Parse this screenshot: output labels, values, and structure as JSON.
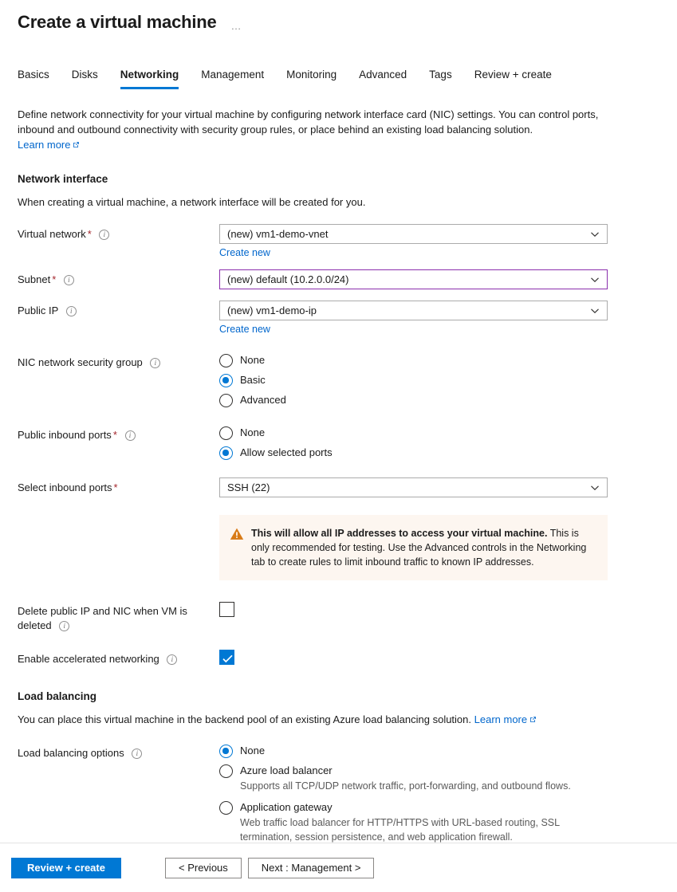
{
  "header": {
    "title": "Create a virtual machine",
    "more_menu": "…"
  },
  "colors": {
    "accent": "#0078d4",
    "link": "#0066cc",
    "required": "#a4262c",
    "warning_icon": "#d87a16",
    "warning_bg": "#fdf6f0",
    "focus_border": "#8b2fad"
  },
  "tabs": [
    {
      "label": "Basics",
      "active": false
    },
    {
      "label": "Disks",
      "active": false
    },
    {
      "label": "Networking",
      "active": true
    },
    {
      "label": "Management",
      "active": false
    },
    {
      "label": "Monitoring",
      "active": false
    },
    {
      "label": "Advanced",
      "active": false
    },
    {
      "label": "Tags",
      "active": false
    },
    {
      "label": "Review + create",
      "active": false
    }
  ],
  "intro": {
    "text": "Define network connectivity for your virtual machine by configuring network interface card (NIC) settings. You can control ports, inbound and outbound connectivity with security group rules, or place behind an existing load balancing solution.",
    "learn_more": "Learn more"
  },
  "network_interface": {
    "heading": "Network interface",
    "subtext": "When creating a virtual machine, a network interface will be created for you.",
    "virtual_network": {
      "label": "Virtual network",
      "required": "*",
      "value": "(new) vm1-demo-vnet",
      "create_new": "Create new",
      "focused": false
    },
    "subnet": {
      "label": "Subnet",
      "required": "*",
      "value": "(new) default (10.2.0.0/24)",
      "focused": true
    },
    "public_ip": {
      "label": "Public IP",
      "value": "(new) vm1-demo-ip",
      "create_new": "Create new",
      "focused": false
    },
    "nic_nsg": {
      "label": "NIC network security group",
      "selected": "Basic",
      "options": [
        "None",
        "Basic",
        "Advanced"
      ]
    },
    "public_inbound_ports": {
      "label": "Public inbound ports",
      "required": "*",
      "selected": "Allow selected ports",
      "options": [
        "None",
        "Allow selected ports"
      ]
    },
    "select_inbound_ports": {
      "label": "Select inbound ports",
      "required": "*",
      "value": "SSH (22)"
    },
    "warning": {
      "icon": "warning-triangle-icon",
      "strong": "This will allow all IP addresses to access your virtual machine.",
      "rest": "This is only recommended for testing.  Use the Advanced controls in the Networking tab to create rules to limit inbound traffic to known IP addresses."
    },
    "delete_public_ip": {
      "label": "Delete public IP and NIC when VM is deleted",
      "checked": false
    },
    "accelerated_networking": {
      "label": "Enable accelerated networking",
      "checked": true
    }
  },
  "load_balancing": {
    "heading": "Load balancing",
    "subtext": "You can place this virtual machine in the backend pool of an existing Azure load balancing solution.",
    "learn_more": "Learn more",
    "options_label": "Load balancing options",
    "selected": "None",
    "options": [
      {
        "label": "None",
        "desc": ""
      },
      {
        "label": "Azure load balancer",
        "desc": "Supports all TCP/UDP network traffic, port-forwarding, and outbound flows."
      },
      {
        "label": "Application gateway",
        "desc": "Web traffic load balancer for HTTP/HTTPS with URL-based routing, SSL termination, session persistence, and web application firewall."
      }
    ]
  },
  "footer": {
    "review_create": "Review + create",
    "previous": "< Previous",
    "next": "Next : Management >"
  }
}
